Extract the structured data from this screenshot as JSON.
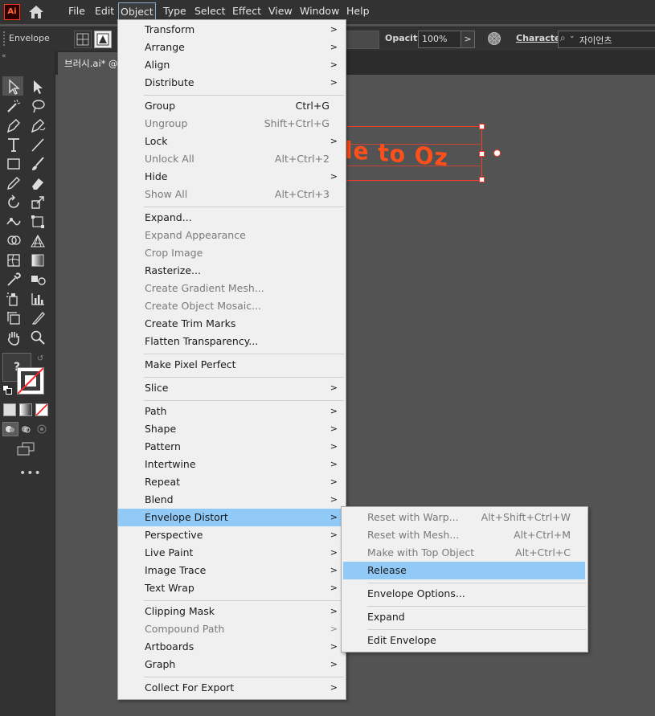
{
  "app": {
    "logo_text": "Ai"
  },
  "menubar": {
    "items": [
      "File",
      "Edit",
      "Object",
      "Type",
      "Select",
      "Effect",
      "View",
      "Window",
      "Help"
    ],
    "active": "Object"
  },
  "controlbar": {
    "selection_label": "Envelope",
    "opacity_label": "Opacity:",
    "opacity_value": "100%",
    "character_label": "Character:",
    "font_value": "자이언츠"
  },
  "document": {
    "tab_title": "브러시.ai* @",
    "artwork_text": "le to Oz"
  },
  "object_menu": {
    "items": [
      {
        "label": "Transform",
        "shortcut": "",
        "submenu": true,
        "disabled": false
      },
      {
        "label": "Arrange",
        "shortcut": "",
        "submenu": true,
        "disabled": false
      },
      {
        "label": "Align",
        "shortcut": "",
        "submenu": true,
        "disabled": false
      },
      {
        "label": "Distribute",
        "shortcut": "",
        "submenu": true,
        "disabled": false
      },
      {
        "label": "Group",
        "shortcut": "Ctrl+G",
        "submenu": false,
        "disabled": false
      },
      {
        "label": "Ungroup",
        "shortcut": "Shift+Ctrl+G",
        "submenu": false,
        "disabled": true
      },
      {
        "label": "Lock",
        "shortcut": "",
        "submenu": true,
        "disabled": false
      },
      {
        "label": "Unlock All",
        "shortcut": "Alt+Ctrl+2",
        "submenu": false,
        "disabled": true
      },
      {
        "label": "Hide",
        "shortcut": "",
        "submenu": true,
        "disabled": false
      },
      {
        "label": "Show All",
        "shortcut": "Alt+Ctrl+3",
        "submenu": false,
        "disabled": true
      },
      {
        "label": "Expand...",
        "shortcut": "",
        "submenu": false,
        "disabled": false
      },
      {
        "label": "Expand Appearance",
        "shortcut": "",
        "submenu": false,
        "disabled": true
      },
      {
        "label": "Crop Image",
        "shortcut": "",
        "submenu": false,
        "disabled": true
      },
      {
        "label": "Rasterize...",
        "shortcut": "",
        "submenu": false,
        "disabled": false
      },
      {
        "label": "Create Gradient Mesh...",
        "shortcut": "",
        "submenu": false,
        "disabled": true
      },
      {
        "label": "Create Object Mosaic...",
        "shortcut": "",
        "submenu": false,
        "disabled": true
      },
      {
        "label": "Create Trim Marks",
        "shortcut": "",
        "submenu": false,
        "disabled": false
      },
      {
        "label": "Flatten Transparency...",
        "shortcut": "",
        "submenu": false,
        "disabled": false
      },
      {
        "label": "Make Pixel Perfect",
        "shortcut": "",
        "submenu": false,
        "disabled": false
      },
      {
        "label": "Slice",
        "shortcut": "",
        "submenu": true,
        "disabled": false
      },
      {
        "label": "Path",
        "shortcut": "",
        "submenu": true,
        "disabled": false
      },
      {
        "label": "Shape",
        "shortcut": "",
        "submenu": true,
        "disabled": false
      },
      {
        "label": "Pattern",
        "shortcut": "",
        "submenu": true,
        "disabled": false
      },
      {
        "label": "Intertwine",
        "shortcut": "",
        "submenu": true,
        "disabled": false
      },
      {
        "label": "Repeat",
        "shortcut": "",
        "submenu": true,
        "disabled": false
      },
      {
        "label": "Blend",
        "shortcut": "",
        "submenu": true,
        "disabled": false
      },
      {
        "label": "Envelope Distort",
        "shortcut": "",
        "submenu": true,
        "disabled": false,
        "highlighted": true
      },
      {
        "label": "Perspective",
        "shortcut": "",
        "submenu": true,
        "disabled": false
      },
      {
        "label": "Live Paint",
        "shortcut": "",
        "submenu": true,
        "disabled": false
      },
      {
        "label": "Image Trace",
        "shortcut": "",
        "submenu": true,
        "disabled": false
      },
      {
        "label": "Text Wrap",
        "shortcut": "",
        "submenu": true,
        "disabled": false
      },
      {
        "label": "Clipping Mask",
        "shortcut": "",
        "submenu": true,
        "disabled": false
      },
      {
        "label": "Compound Path",
        "shortcut": "",
        "submenu": true,
        "disabled": true
      },
      {
        "label": "Artboards",
        "shortcut": "",
        "submenu": true,
        "disabled": false
      },
      {
        "label": "Graph",
        "shortcut": "",
        "submenu": true,
        "disabled": false
      },
      {
        "label": "Collect For Export",
        "shortcut": "",
        "submenu": true,
        "disabled": false
      }
    ]
  },
  "envelope_submenu": {
    "items": [
      {
        "label": "Reset with Warp...",
        "shortcut": "Alt+Shift+Ctrl+W",
        "disabled": true
      },
      {
        "label": "Reset with Mesh...",
        "shortcut": "Alt+Ctrl+M",
        "disabled": true
      },
      {
        "label": "Make with Top Object",
        "shortcut": "Alt+Ctrl+C",
        "disabled": true
      },
      {
        "label": "Release",
        "shortcut": "",
        "disabled": false,
        "highlighted": true
      },
      {
        "label": "Envelope Options...",
        "shortcut": "",
        "disabled": false
      },
      {
        "label": "Expand",
        "shortcut": "",
        "disabled": false
      },
      {
        "label": "Edit Envelope",
        "shortcut": "",
        "disabled": false
      }
    ]
  },
  "colors": {
    "accent_highlight": "#91c9f7",
    "selection": "#ff3a28",
    "artwork": "#ff4f1a"
  }
}
